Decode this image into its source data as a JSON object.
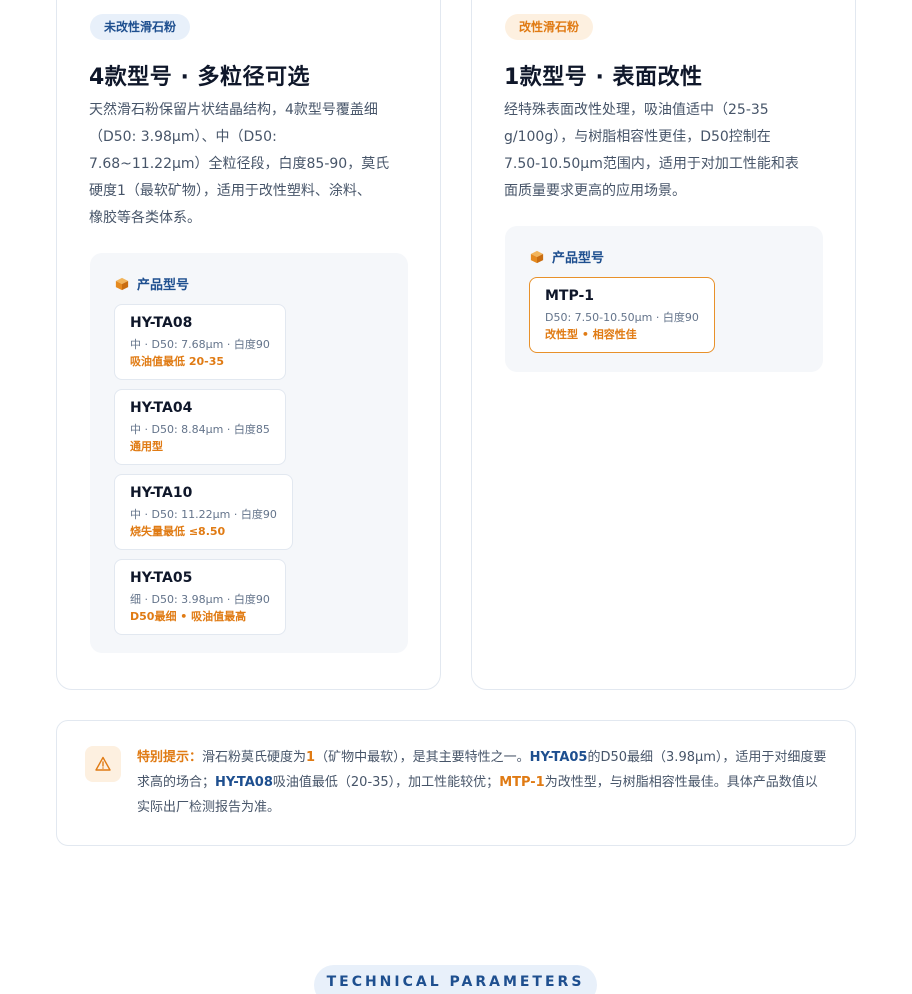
{
  "left_card": {
    "badge": "未改性滑石粉",
    "title": "4款型号 · 多粒径可选",
    "desc_lines": [
      "天然滑石粉保留片状结晶结构，4款型号覆盖细",
      "（D50: 3.98μm）、中（D50:",
      "7.68~11.22μm）全粒径段，白度85-90，莫氏",
      "硬度1（最软矿物），适用于改性塑料、涂料、",
      "橡胶等各类体系。"
    ],
    "panel_title": "产品型号",
    "products": [
      {
        "name": "HY-TA08",
        "spec": "中 · D50: 7.68μm · 白度90",
        "tag": "吸油值最低 20-35"
      },
      {
        "name": "HY-TA04",
        "spec": "中 · D50: 8.84μm · 白度85",
        "tag": "通用型"
      },
      {
        "name": "HY-TA10",
        "spec": "中 · D50: 11.22μm · 白度90",
        "tag": "烧失量最低 ≤8.50"
      },
      {
        "name": "HY-TA05",
        "spec": "细 · D50: 3.98μm · 白度90",
        "tag": "D50最细 • 吸油值最高"
      }
    ]
  },
  "right_card": {
    "badge": "改性滑石粉",
    "title": "1款型号 · 表面改性",
    "desc_lines": [
      "经特殊表面改性处理，吸油值适中（25-35",
      "g/100g），与树脂相容性更佳，D50控制在",
      "7.50-10.50μm范围内，适用于对加工性能和表",
      "面质量要求更高的应用场景。"
    ],
    "panel_title": "产品型号",
    "products": [
      {
        "name": "MTP-1",
        "spec": "D50: 7.50-10.50μm · 白度90",
        "tag": "改性型 • 相容性佳"
      }
    ]
  },
  "notice": {
    "label": "特别提示：",
    "t1": "滑石粉莫氏硬度为",
    "hardness": "1",
    "t2": "（矿物中最软），是其主要特性之一。",
    "m1": "HY-TA05",
    "t3": "的D50最细（3.98μm），适用于对细度要求高的场合；",
    "m2": "HY-TA08",
    "t4": "吸油值最低（20-35），加工性能较优；",
    "m3": "MTP-1",
    "t5": "为改性型，与树脂相容性最佳。具体产品数值以实际出厂检测报告为准。"
  },
  "section_label": "TECHNICAL PARAMETERS",
  "colors": {
    "accent_blue": "#1e4f8f",
    "accent_orange": "#e07b14"
  }
}
